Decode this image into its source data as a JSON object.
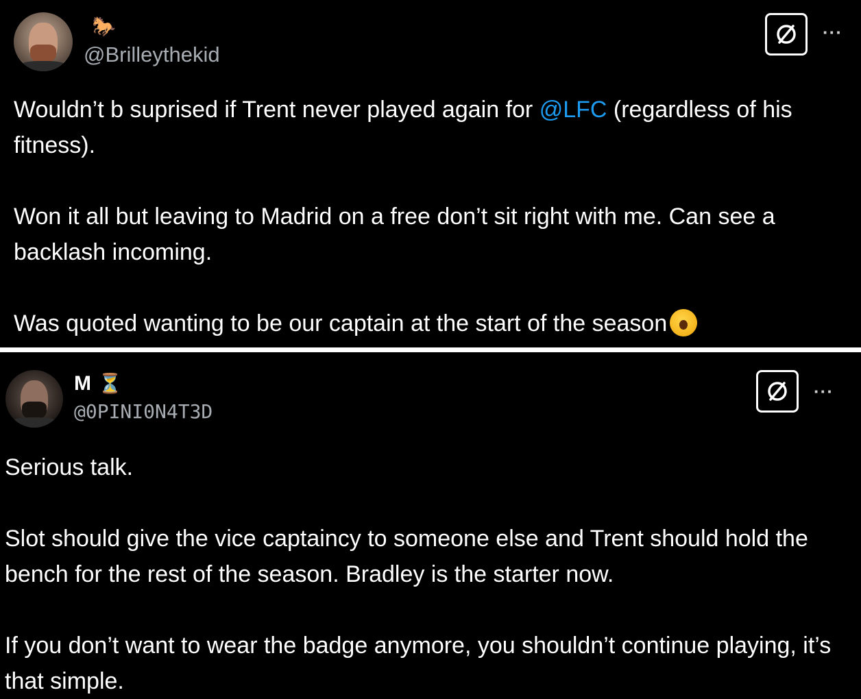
{
  "tweets": [
    {
      "display_name": "",
      "name_emoji": "🐎",
      "handle": "@Brilleythekid",
      "paragraphs": [
        {
          "before": "Wouldn’t b suprised if Trent never played again for ",
          "mention": "@LFC",
          "after": " (regardless of his fitness)."
        },
        {
          "text": "Won it all but leaving to Madrid on a free don’t sit right with me. Can see a backlash incoming."
        },
        {
          "text": "Was quoted wanting to be our captain at the start of the season",
          "emoji": "yawning-face-icon"
        }
      ]
    },
    {
      "display_name": "M",
      "name_emoji": "⏳",
      "handle": "@0PINI0N4T3D",
      "paragraphs": [
        {
          "text": "Serious talk."
        },
        {
          "text": "Slot should give the vice captaincy to someone else and Trent should hold the bench for the rest of the season. Bradley is the starter now."
        },
        {
          "text": "If you don’t want to wear the badge anymore, you shouldn’t continue playing, it’s that simple."
        }
      ]
    }
  ],
  "more_label": "···",
  "colors": {
    "background": "#000000",
    "text": "#ffffff",
    "handle": "#a7adb3",
    "mention": "#1d9bf0",
    "separator": "#ffffff"
  }
}
